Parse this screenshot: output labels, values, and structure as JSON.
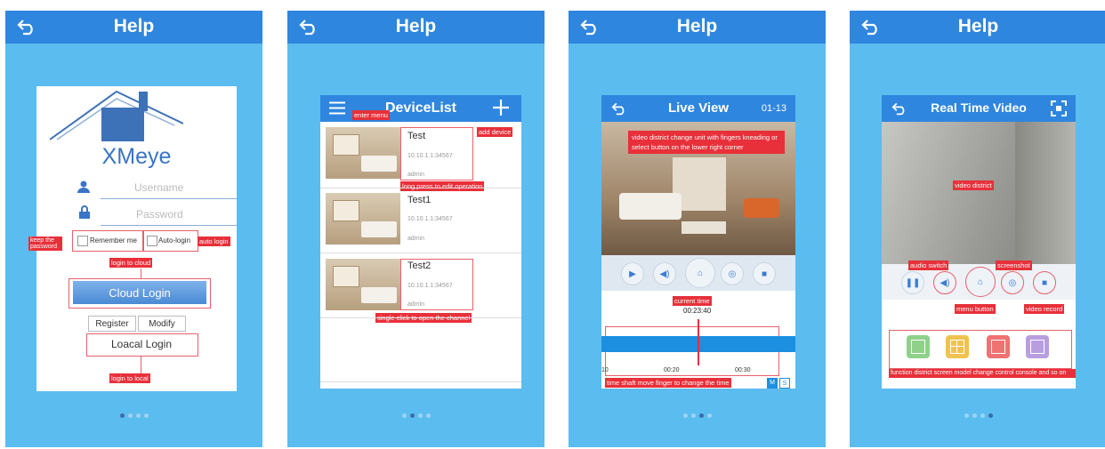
{
  "header_title": "Help",
  "login": {
    "brand": "XMeye",
    "username_placeholder": "Username",
    "password_placeholder": "Password",
    "remember_me": "Remember me",
    "auto_login": "Auto-login",
    "cloud_login": "Cloud Login",
    "register": "Register",
    "modify": "Modify",
    "local_login": "Loacal Login",
    "ann_keep_password": "keep the password",
    "ann_auto_login": "auto login",
    "ann_login_cloud": "login to cloud",
    "ann_login_local": "login to local"
  },
  "devicelist": {
    "title": "DeviceList",
    "devices": [
      {
        "name": "Test",
        "ip": "10.10.1.1:34567",
        "user": "admin"
      },
      {
        "name": "Test1",
        "ip": "10.10.1.1:34567",
        "user": "admin"
      },
      {
        "name": "Test2",
        "ip": "10.10.1.1:34567",
        "user": "admin"
      }
    ],
    "ann_enter_menu": "enter menu",
    "ann_add_device": "add device",
    "ann_long_press": "long press to edit operation",
    "ann_single_click": "single click to open the channel"
  },
  "liveview": {
    "title": "Live View",
    "date": "01-13",
    "time": "00:23:40",
    "ticks": [
      "10",
      "00:20",
      "00:30"
    ],
    "m_label": "M",
    "s_label": "S",
    "ann_video_district": "video district change unit with fingers kneading or select button on the lower right corner",
    "ann_current_time": "current time",
    "ann_time_shaft": "time shaft move finger to change the time"
  },
  "realtime": {
    "title": "Real Time Video",
    "ann_video_district": "video district",
    "ann_audio_switch": "audio switch",
    "ann_screenshot": "screenshot",
    "ann_menu_button": "menu button",
    "ann_video_record": "video record",
    "ann_function_district": "function district screen model change control console and so on"
  },
  "colors": {
    "panel_bg": "#5bbcf0",
    "header": "#2f86de",
    "annotation": "#e8303a"
  }
}
